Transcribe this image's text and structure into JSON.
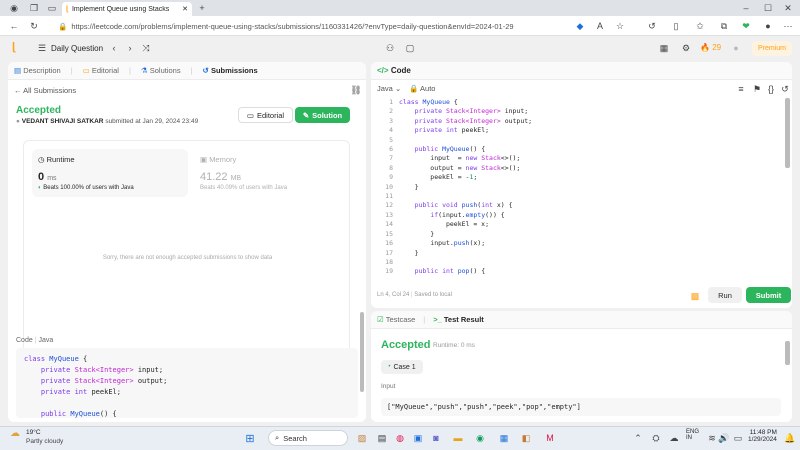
{
  "browser": {
    "tab_title": "Implement Queue using Stacks",
    "url": "https://leetcode.com/problems/implement-queue-using-stacks/submissions/1160331426/?envType=daily-question&envId=2024-01-29"
  },
  "nav": {
    "daily_question": "Daily Question",
    "streak": "29",
    "premium": "Premium"
  },
  "left": {
    "tabs": [
      "Description",
      "Editorial",
      "Solutions",
      "Submissions"
    ],
    "all_submissions": "All Submissions",
    "status": "Accepted",
    "author": "VEDANT SHIVAJI SATKAR",
    "submitted": "submitted at Jan 29, 2024 23:49",
    "editorial_btn": "Editorial",
    "solution_btn": "Solution",
    "runtime_label": "Runtime",
    "runtime_value": "0",
    "runtime_unit": "ms",
    "runtime_beats": "Beats 100.00% of users with Java",
    "memory_label": "Memory",
    "memory_value": "41.22",
    "memory_unit": "MB",
    "memory_beats": "Beats 40.09% of users with Java",
    "not_enough": "Sorry, there are not enough accepted submissions to show data",
    "code_label": "Code",
    "code_lang": "Java",
    "code_lines": [
      "class MyQueue {",
      "    private Stack<Integer> input;",
      "    private Stack<Integer> output;",
      "    private int peekEl;",
      "",
      "    public MyQueue() {"
    ]
  },
  "editor": {
    "title": "Code",
    "lang": "Java",
    "auto": "Auto",
    "line_numbers": [
      "1",
      "2",
      "3",
      "4",
      "5",
      "6",
      "7",
      "8",
      "9",
      "10",
      "11",
      "12",
      "13",
      "14",
      "15",
      "16",
      "17",
      "18",
      "19"
    ],
    "status": "Ln 4, Col 24",
    "saved": "Saved to local",
    "run": "Run",
    "submit": "Submit"
  },
  "result": {
    "testcase_tab": "Testcase",
    "result_tab": "Test Result",
    "status": "Accepted",
    "runtime": "Runtime: 0 ms",
    "case": "Case 1",
    "input_label": "Input",
    "input_value": "[\"MyQueue\",\"push\",\"push\",\"peek\",\"pop\",\"empty\"]"
  },
  "taskbar": {
    "temp": "19°C",
    "weather": "Partly cloudy",
    "search": "Search",
    "lang1": "ENG",
    "lang2": "IN",
    "time": "11:48 PM",
    "date": "1/29/2024"
  }
}
